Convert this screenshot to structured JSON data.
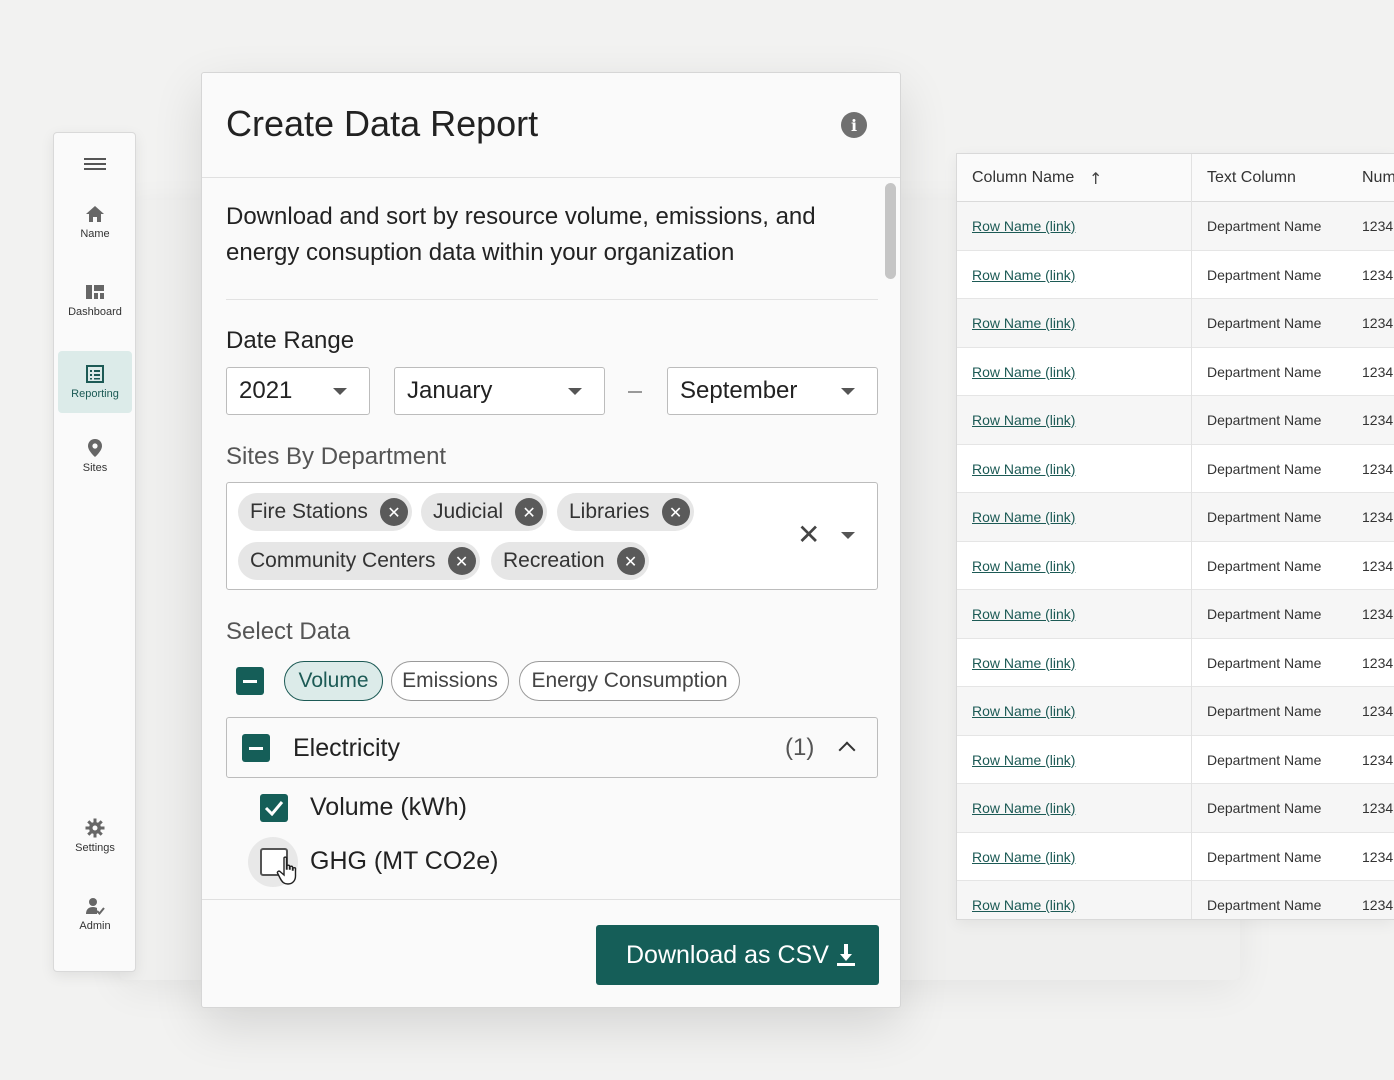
{
  "sidebar": {
    "items": [
      {
        "label": "Name",
        "icon": "home-icon"
      },
      {
        "label": "Dashboard",
        "icon": "dashboard-icon"
      },
      {
        "label": "Reporting",
        "icon": "reporting-icon"
      },
      {
        "label": "Sites",
        "icon": "map-pin-icon"
      },
      {
        "label": "Settings",
        "icon": "gear-icon"
      },
      {
        "label": "Admin",
        "icon": "user-check-icon"
      }
    ]
  },
  "dialog": {
    "title": "Create Data Report",
    "description": "Download and sort by resource volume, emissions, and energy consuption data within your organization",
    "date_range": {
      "label": "Date Range",
      "year": "2021",
      "start_month": "January",
      "end_month": "September"
    },
    "sites": {
      "label": "Sites By Department",
      "chips": [
        "Fire Stations",
        "Judicial",
        "Libraries",
        "Community Centers",
        "Recreation"
      ]
    },
    "select_data": {
      "label": "Select Data",
      "pills": [
        "Volume",
        "Emissions",
        "Energy Consumption"
      ],
      "group": {
        "label": "Electricity",
        "count": "(1)"
      },
      "options": [
        "Volume (kWh)",
        "GHG (MT CO2e)"
      ]
    },
    "download_label": "Download as CSV"
  },
  "table": {
    "headers": [
      "Column Name",
      "Text Column",
      "Num"
    ],
    "rows": [
      [
        "Row Name (link)",
        "Department Name",
        "1234"
      ],
      [
        "Row Name (link)",
        "Department Name",
        "1234"
      ],
      [
        "Row Name (link)",
        "Department Name",
        "1234"
      ],
      [
        "Row Name (link)",
        "Department Name",
        "1234"
      ],
      [
        "Row Name (link)",
        "Department Name",
        "1234"
      ],
      [
        "Row Name (link)",
        "Department Name",
        "1234"
      ],
      [
        "Row Name (link)",
        "Department Name",
        "1234"
      ],
      [
        "Row Name (link)",
        "Department Name",
        "1234"
      ],
      [
        "Row Name (link)",
        "Department Name",
        "1234"
      ],
      [
        "Row Name (link)",
        "Department Name",
        "1234"
      ],
      [
        "Row Name (link)",
        "Department Name",
        "1234"
      ],
      [
        "Row Name (link)",
        "Department Name",
        "1234"
      ],
      [
        "Row Name (link)",
        "Department Name",
        "1234"
      ],
      [
        "Row Name (link)",
        "Department Name",
        "1234"
      ],
      [
        "Row Name (link)",
        "Department Name",
        "1234"
      ]
    ]
  },
  "colors": {
    "accent": "#155e58",
    "accent_light": "#dcebe9",
    "background": "#f2f2f1"
  }
}
